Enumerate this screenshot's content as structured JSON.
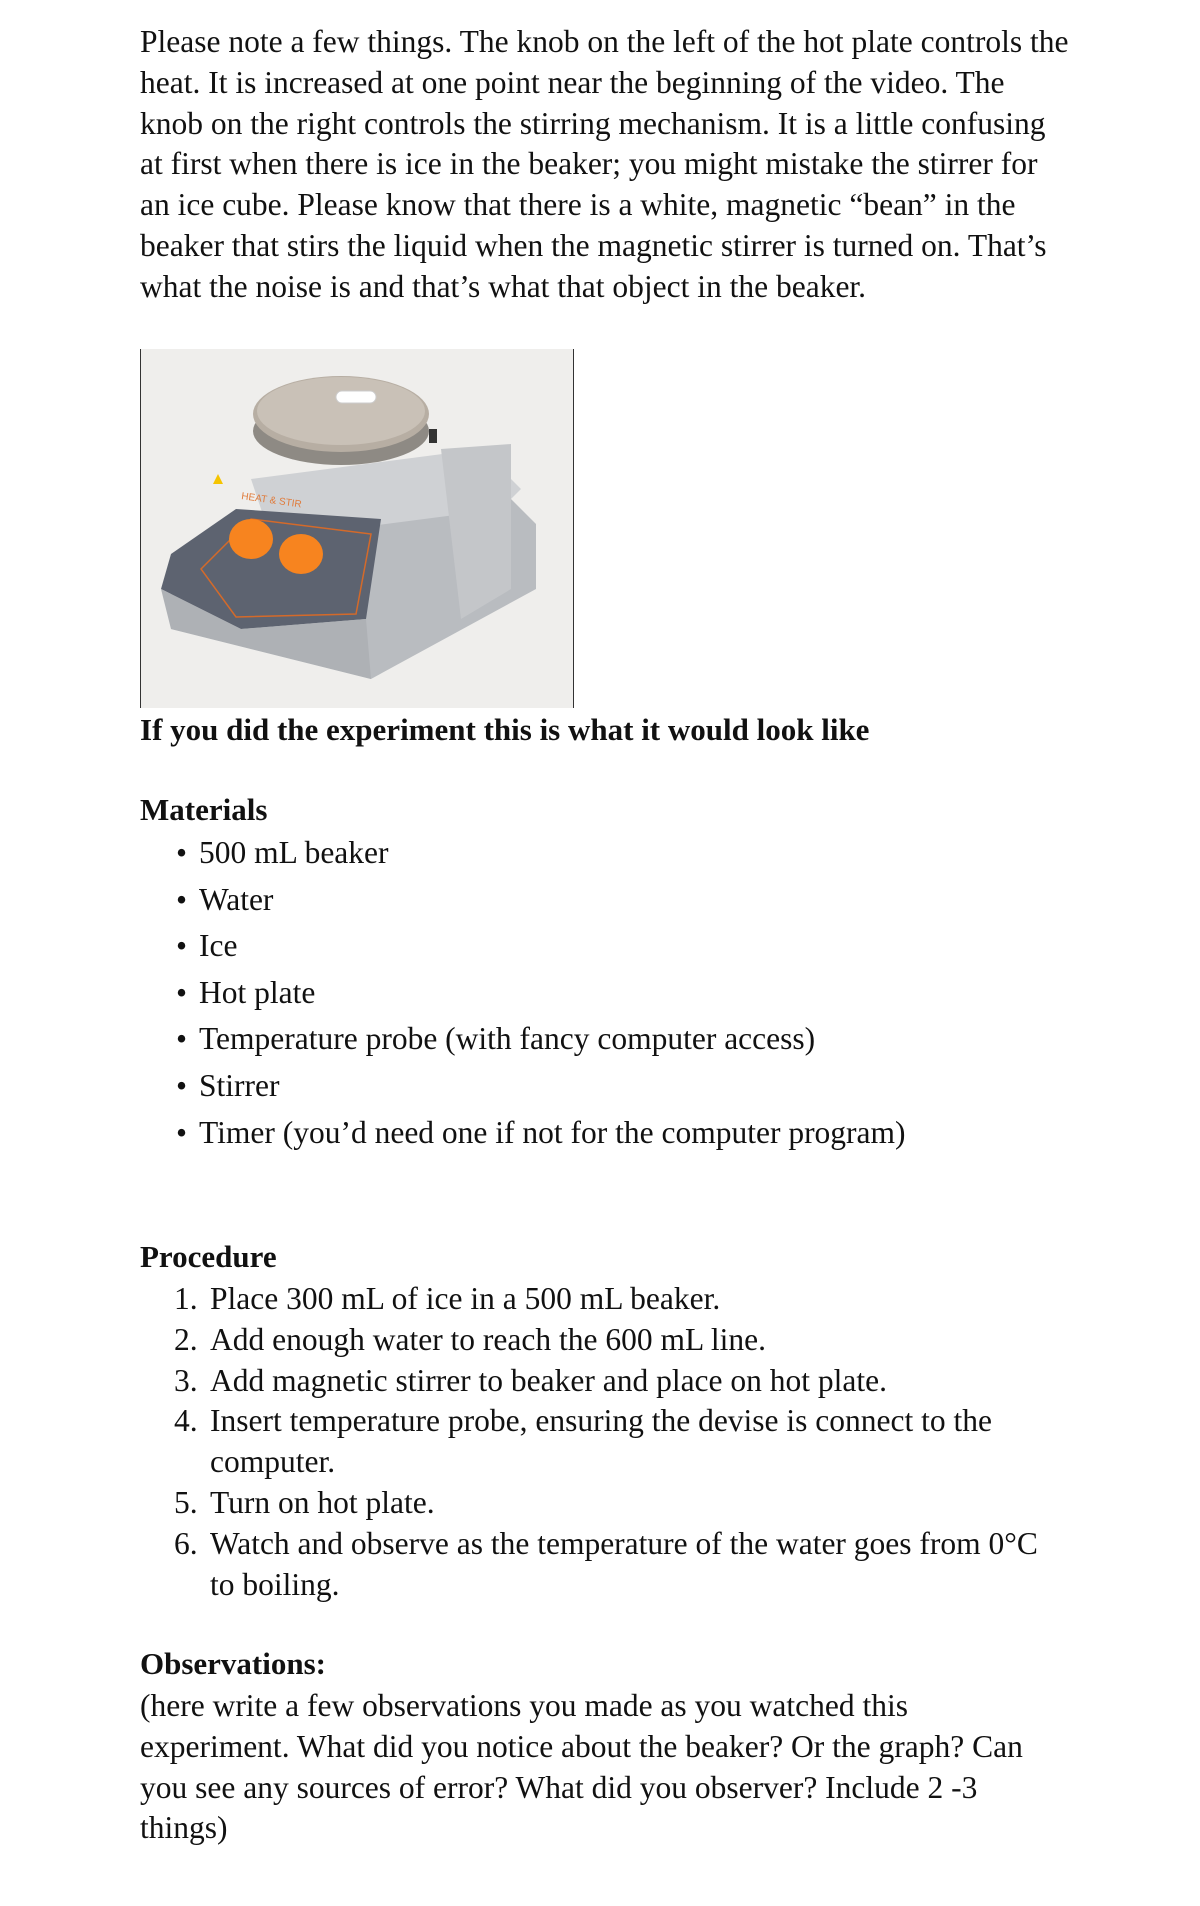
{
  "intro": "Please note a few things. The knob on the left of the hot plate controls the heat. It is increased at one point near the beginning of the video. The knob on the right controls the stirring mechanism. It is a little confusing at first when there is ice in the beaker; you might mistake the stirrer for an ice cube. Please know that there is a white, magnetic “bean” in the beaker that stirs the liquid when the magnetic stirrer is turned on. That’s what the noise is and that’s what that object in the beaker.",
  "photo": {
    "brand_label": "HEAT & STIR",
    "knob_color": "#f7841f"
  },
  "caption": "If you did the experiment this is what it would look like",
  "materials": {
    "heading": "Materials",
    "items": [
      "500 mL beaker",
      "Water",
      "Ice",
      "Hot plate",
      "Temperature probe (with fancy computer access)",
      "Stirrer",
      "Timer (you’d need one if not for the computer program)"
    ]
  },
  "procedure": {
    "heading": "Procedure",
    "steps": [
      {
        "num": "1.",
        "text": "Place 300 mL of ice in a 500 mL beaker."
      },
      {
        "num": "2.",
        "text": "Add enough water to reach the 600 mL line."
      },
      {
        "num": "3.",
        "text": "Add magnetic stirrer to beaker and place on hot plate."
      },
      {
        "num": "4.",
        "text": "Insert temperature probe, ensuring the devise is connect to the computer."
      },
      {
        "num": "5.",
        "text": "Turn on hot plate."
      },
      {
        "num": "6.",
        "text": "Watch and observe as the temperature of the water goes from 0°C to boiling."
      }
    ]
  },
  "observations": {
    "heading": "Observations:",
    "text": "(here write a few observations you made as you watched this experiment. What did you notice about the beaker? Or the graph? Can you see any sources of error? What did you observer? Include 2 -3 things)"
  }
}
